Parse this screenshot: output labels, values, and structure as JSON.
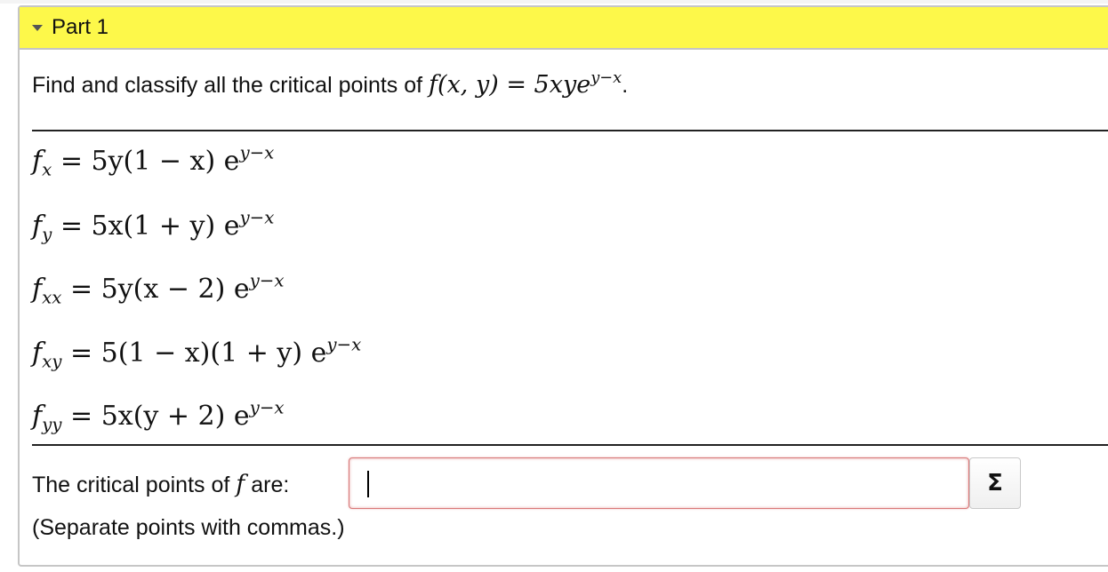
{
  "part": {
    "title": "Part 1"
  },
  "question": {
    "text": "Find and classify all the critical points of",
    "func": "f(x, y) = 5xye",
    "exp": "y−x",
    "end": "."
  },
  "derivatives": [
    {
      "name": "f",
      "sub": "x",
      "rhs": "= 5y(1 − x) e",
      "exp": "y−x"
    },
    {
      "name": "f",
      "sub": "y",
      "rhs": "= 5x(1 + y) e",
      "exp": "y−x"
    },
    {
      "name": "f",
      "sub": "xx",
      "rhs": "= 5y(x − 2) e",
      "exp": "y−x"
    },
    {
      "name": "f",
      "sub": "xy",
      "rhs": "= 5(1 − x)(1 + y) e",
      "exp": "y−x"
    },
    {
      "name": "f",
      "sub": "yy",
      "rhs": "= 5x(y + 2) e",
      "exp": "y−x"
    }
  ],
  "answer": {
    "label": "The critical points of",
    "fname": "f",
    "label_end": "are:",
    "value": "",
    "sigma_label": "Σ",
    "hint": "(Separate points with commas.)"
  },
  "colors": {
    "header_bg": "#fdf84a",
    "input_border_error": "#d97a7a"
  },
  "icons": {
    "header_toggle": "caret-down-icon",
    "math_button": "sigma-icon"
  }
}
